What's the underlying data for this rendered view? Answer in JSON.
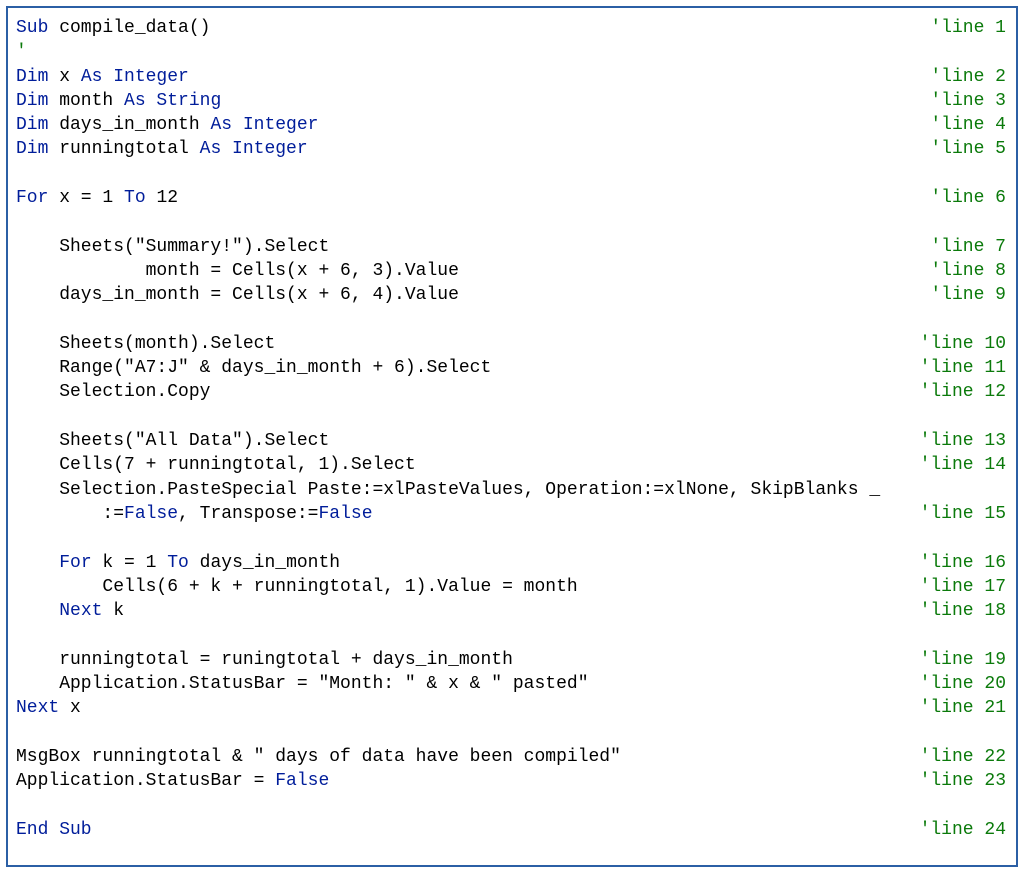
{
  "code": {
    "lines": [
      {
        "left": [
          {
            "t": "Sub",
            "c": "kw"
          },
          {
            "t": " compile_data()"
          }
        ],
        "right": {
          "t": "'line 1",
          "c": "cmt"
        }
      },
      {
        "left": [
          {
            "t": "'",
            "c": "cmt"
          }
        ]
      },
      {
        "left": [
          {
            "t": "Dim",
            "c": "kw"
          },
          {
            "t": " x "
          },
          {
            "t": "As Integer",
            "c": "kw"
          }
        ],
        "right": {
          "t": "'line 2",
          "c": "cmt"
        }
      },
      {
        "left": [
          {
            "t": "Dim",
            "c": "kw"
          },
          {
            "t": " month "
          },
          {
            "t": "As String",
            "c": "kw"
          }
        ],
        "right": {
          "t": "'line 3",
          "c": "cmt"
        }
      },
      {
        "left": [
          {
            "t": "Dim",
            "c": "kw"
          },
          {
            "t": " days_in_month "
          },
          {
            "t": "As Integer",
            "c": "kw"
          }
        ],
        "right": {
          "t": "'line 4",
          "c": "cmt"
        }
      },
      {
        "left": [
          {
            "t": "Dim",
            "c": "kw"
          },
          {
            "t": " runningtotal "
          },
          {
            "t": "As Integer",
            "c": "kw"
          }
        ],
        "right": {
          "t": "'line 5",
          "c": "cmt"
        }
      },
      {
        "blank": true
      },
      {
        "left": [
          {
            "t": "For",
            "c": "kw"
          },
          {
            "t": " x = 1 "
          },
          {
            "t": "To",
            "c": "kw"
          },
          {
            "t": " 12"
          }
        ],
        "right": {
          "t": "'line 6",
          "c": "cmt"
        }
      },
      {
        "blank": true
      },
      {
        "left": [
          {
            "t": "    Sheets(\"Summary!\").Select"
          }
        ],
        "right": {
          "t": "'line 7",
          "c": "cmt"
        }
      },
      {
        "left": [
          {
            "t": "            month = Cells(x + 6, 3).Value"
          }
        ],
        "right": {
          "t": "'line 8",
          "c": "cmt"
        }
      },
      {
        "left": [
          {
            "t": "    days_in_month = Cells(x + 6, 4).Value"
          }
        ],
        "right": {
          "t": "'line 9",
          "c": "cmt"
        }
      },
      {
        "blank": true
      },
      {
        "left": [
          {
            "t": "    Sheets(month).Select"
          }
        ],
        "right": {
          "t": "'line 10",
          "c": "cmt"
        }
      },
      {
        "left": [
          {
            "t": "    Range(\"A7:J\" & days_in_month + 6).Select"
          }
        ],
        "right": {
          "t": "'line 11",
          "c": "cmt"
        }
      },
      {
        "left": [
          {
            "t": "    Selection.Copy"
          }
        ],
        "right": {
          "t": "'line 12",
          "c": "cmt"
        }
      },
      {
        "blank": true
      },
      {
        "left": [
          {
            "t": "    Sheets(\"All Data\").Select"
          }
        ],
        "right": {
          "t": "'line 13",
          "c": "cmt"
        }
      },
      {
        "left": [
          {
            "t": "    Cells(7 + runningtotal, 1).Select"
          }
        ],
        "right": {
          "t": "'line 14",
          "c": "cmt"
        }
      },
      {
        "left": [
          {
            "t": "    Selection.PasteSpecial Paste:=xlPasteValues, Operation:=xlNone, SkipBlanks _"
          }
        ]
      },
      {
        "left": [
          {
            "t": "        :="
          },
          {
            "t": "False",
            "c": "kw"
          },
          {
            "t": ", Transpose:="
          },
          {
            "t": "False",
            "c": "kw"
          }
        ],
        "right": {
          "t": "'line 15",
          "c": "cmt"
        }
      },
      {
        "blank": true
      },
      {
        "left": [
          {
            "t": "    "
          },
          {
            "t": "For",
            "c": "kw"
          },
          {
            "t": " k = 1 "
          },
          {
            "t": "To",
            "c": "kw"
          },
          {
            "t": " days_in_month"
          }
        ],
        "right": {
          "t": "'line 16",
          "c": "cmt"
        }
      },
      {
        "left": [
          {
            "t": "        Cells(6 + k + runningtotal, 1).Value = month"
          }
        ],
        "right": {
          "t": "'line 17",
          "c": "cmt"
        }
      },
      {
        "left": [
          {
            "t": "    "
          },
          {
            "t": "Next",
            "c": "kw"
          },
          {
            "t": " k"
          }
        ],
        "right": {
          "t": "'line 18",
          "c": "cmt"
        }
      },
      {
        "blank": true
      },
      {
        "left": [
          {
            "t": "    runningtotal = runingtotal + days_in_month"
          }
        ],
        "right": {
          "t": "'line 19",
          "c": "cmt"
        }
      },
      {
        "left": [
          {
            "t": "    Application.StatusBar = \"Month: \" & x & \" pasted\""
          }
        ],
        "right": {
          "t": "'line 20",
          "c": "cmt"
        }
      },
      {
        "left": [
          {
            "t": "Next",
            "c": "kw"
          },
          {
            "t": " x"
          }
        ],
        "right": {
          "t": "'line 21",
          "c": "cmt"
        }
      },
      {
        "blank": true
      },
      {
        "left": [
          {
            "t": "MsgBox runningtotal & \" days of data have been compiled\""
          }
        ],
        "right": {
          "t": "'line 22",
          "c": "cmt"
        }
      },
      {
        "left": [
          {
            "t": "Application.StatusBar = "
          },
          {
            "t": "False",
            "c": "kw"
          }
        ],
        "right": {
          "t": "'line 23",
          "c": "cmt"
        }
      },
      {
        "blank": true
      },
      {
        "left": [
          {
            "t": "End Sub",
            "c": "kw"
          }
        ],
        "right": {
          "t": "'line 24",
          "c": "cmt"
        }
      }
    ]
  }
}
